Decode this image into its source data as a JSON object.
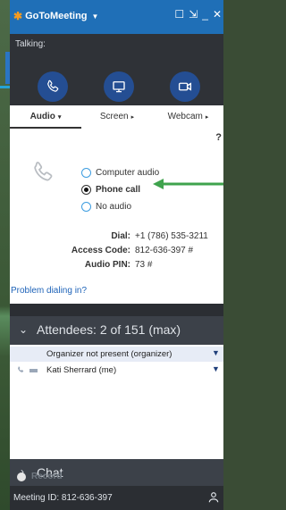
{
  "app": {
    "name": "GoToMeeting"
  },
  "window_controls": {
    "restore": "☐",
    "compact": "⇲",
    "minimize": "_",
    "close": "✕"
  },
  "talking_label": "Talking:",
  "tabs": [
    {
      "label": "Audio",
      "arrow": "▾",
      "active": true
    },
    {
      "label": "Screen",
      "arrow": "▸",
      "active": false
    },
    {
      "label": "Webcam",
      "arrow": "▸",
      "active": false
    }
  ],
  "help_label": "?",
  "audio_options": [
    {
      "label": "Computer audio",
      "selected": false
    },
    {
      "label": "Phone call",
      "selected": true
    },
    {
      "label": "No audio",
      "selected": false
    }
  ],
  "dial_info": {
    "dial_label": "Dial:",
    "dial_value": "+1 (786) 535-3211",
    "access_label": "Access Code:",
    "access_value": "812-636-397 #",
    "pin_label": "Audio PIN:",
    "pin_value": "73 #"
  },
  "problem_link": "Problem dialing in?",
  "attendees": {
    "header": "Attendees:  2 of 151 (max)",
    "rows": [
      {
        "name": "Organizer not present  (organizer)"
      },
      {
        "name": "Kati Sherrard  (me)"
      }
    ]
  },
  "chat_label": "Chat",
  "record_label": "Record",
  "meeting_id": "Meeting ID: 812-636-397",
  "colors": {
    "titlebar": "#1f6fb7",
    "logo_accent": "#f29b22",
    "control_circle": "#244e93",
    "arrow": "#3fa34d",
    "link": "#1e63b8"
  },
  "icons": {
    "call": "phone-icon",
    "screen": "monitor-icon",
    "webcam": "camera-icon"
  }
}
